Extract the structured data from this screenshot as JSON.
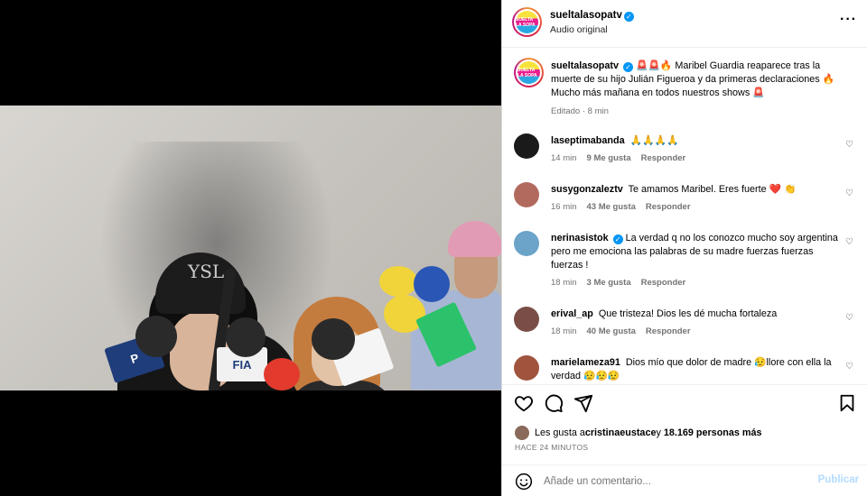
{
  "header": {
    "username": "sueltalasopatv",
    "subtitle": "Audio original",
    "more_icon": "more-horizontal-icon",
    "avatar_logo": "SUELTA LA SOPA"
  },
  "caption": {
    "username": "sueltalasopatv",
    "text": "🚨🚨🔥 Maribel Guardia reaparece tras la muerte de su hijo Julián Figueroa y da primeras declaraciones 🔥 Mucho más mañana en todos nuestros shows 🚨",
    "meta": "Editado · 8 min"
  },
  "comments": [
    {
      "username": "laseptimabanda",
      "text": "🙏🙏🙏🙏",
      "time": "14 min",
      "likes": "9 Me gusta",
      "reply": "Responder",
      "avatar_color": "#1a1a1a"
    },
    {
      "username": "susygonzaleztv",
      "text": "Te amamos Maribel. Eres fuerte ❤️ 👏",
      "time": "16 min",
      "likes": "43 Me gusta",
      "reply": "Responder",
      "avatar_color": "#b36a5e"
    },
    {
      "username": "nerinasistok",
      "verified": true,
      "text": "La verdad q no los conozco mucho soy argentina pero me emociona las palabras de su madre fuerzas fuerzas fuerzas !",
      "time": "18 min",
      "likes": "3 Me gusta",
      "reply": "Responder",
      "avatar_color": "#6ba3c9"
    },
    {
      "username": "erival_ap",
      "text": "Que tristeza! Dios les dé mucha fortaleza",
      "time": "18 min",
      "likes": "40 Me gusta",
      "reply": "Responder",
      "avatar_color": "#7a4e46"
    },
    {
      "username": "marielameza91",
      "text": "Dios mío que dolor de madre 😥llore con ella la verdad 😥😥😥",
      "avatar_color": "#a0543e"
    }
  ],
  "actions": {
    "like_icon": "heart-icon",
    "comment_icon": "comment-icon",
    "share_icon": "share-icon",
    "save_icon": "bookmark-icon"
  },
  "likes": {
    "prefix": "Les gusta a ",
    "user": "cristinaeustace",
    "middle": " y ",
    "count": "18.169 personas más"
  },
  "timestamp": "HACE 24 MINUTOS",
  "comment_box": {
    "placeholder": "Añade un comentario...",
    "publish_label": "Publicar",
    "emoji_icon": "emoji-smile-icon"
  },
  "video": {
    "cap_logo": "YSL",
    "mic_labels": [
      "FIA",
      "P"
    ],
    "volume_icon": "speaker-icon",
    "volume_glyph": "🔈"
  },
  "colors": {
    "accent": "#0095f6",
    "publish_disabled": "#b3dbff",
    "meta_gray": "#737373"
  }
}
